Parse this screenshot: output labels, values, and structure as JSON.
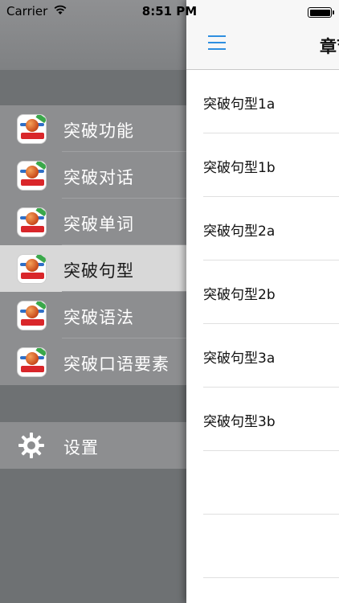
{
  "status_bar": {
    "carrier": "Carrier",
    "time": "8:51 PM",
    "battery_level": 1.0
  },
  "drawer": {
    "items": [
      {
        "label": "突破功能",
        "icon": "app-icon",
        "selected": false
      },
      {
        "label": "突破对话",
        "icon": "app-icon",
        "selected": false
      },
      {
        "label": "突破单词",
        "icon": "app-icon",
        "selected": false
      },
      {
        "label": "突破句型",
        "icon": "app-icon",
        "selected": true
      },
      {
        "label": "突破语法",
        "icon": "app-icon",
        "selected": false
      },
      {
        "label": "突破口语要素",
        "icon": "app-icon",
        "selected": false
      }
    ],
    "settings": {
      "label": "设置",
      "icon": "gear-icon"
    }
  },
  "main": {
    "title": "章节",
    "rows": [
      {
        "label": "突破句型1a"
      },
      {
        "label": "突破句型1b"
      },
      {
        "label": "突破句型2a"
      },
      {
        "label": "突破句型2b"
      },
      {
        "label": "突破句型3a"
      },
      {
        "label": "突破句型3b"
      },
      {
        "label": ""
      },
      {
        "label": ""
      }
    ]
  },
  "colors": {
    "accent": "#2f8fe0",
    "drawer_bg": "#6e7173",
    "menu_bg": "#8d8e90",
    "selected_bg": "#d8d8d8"
  }
}
